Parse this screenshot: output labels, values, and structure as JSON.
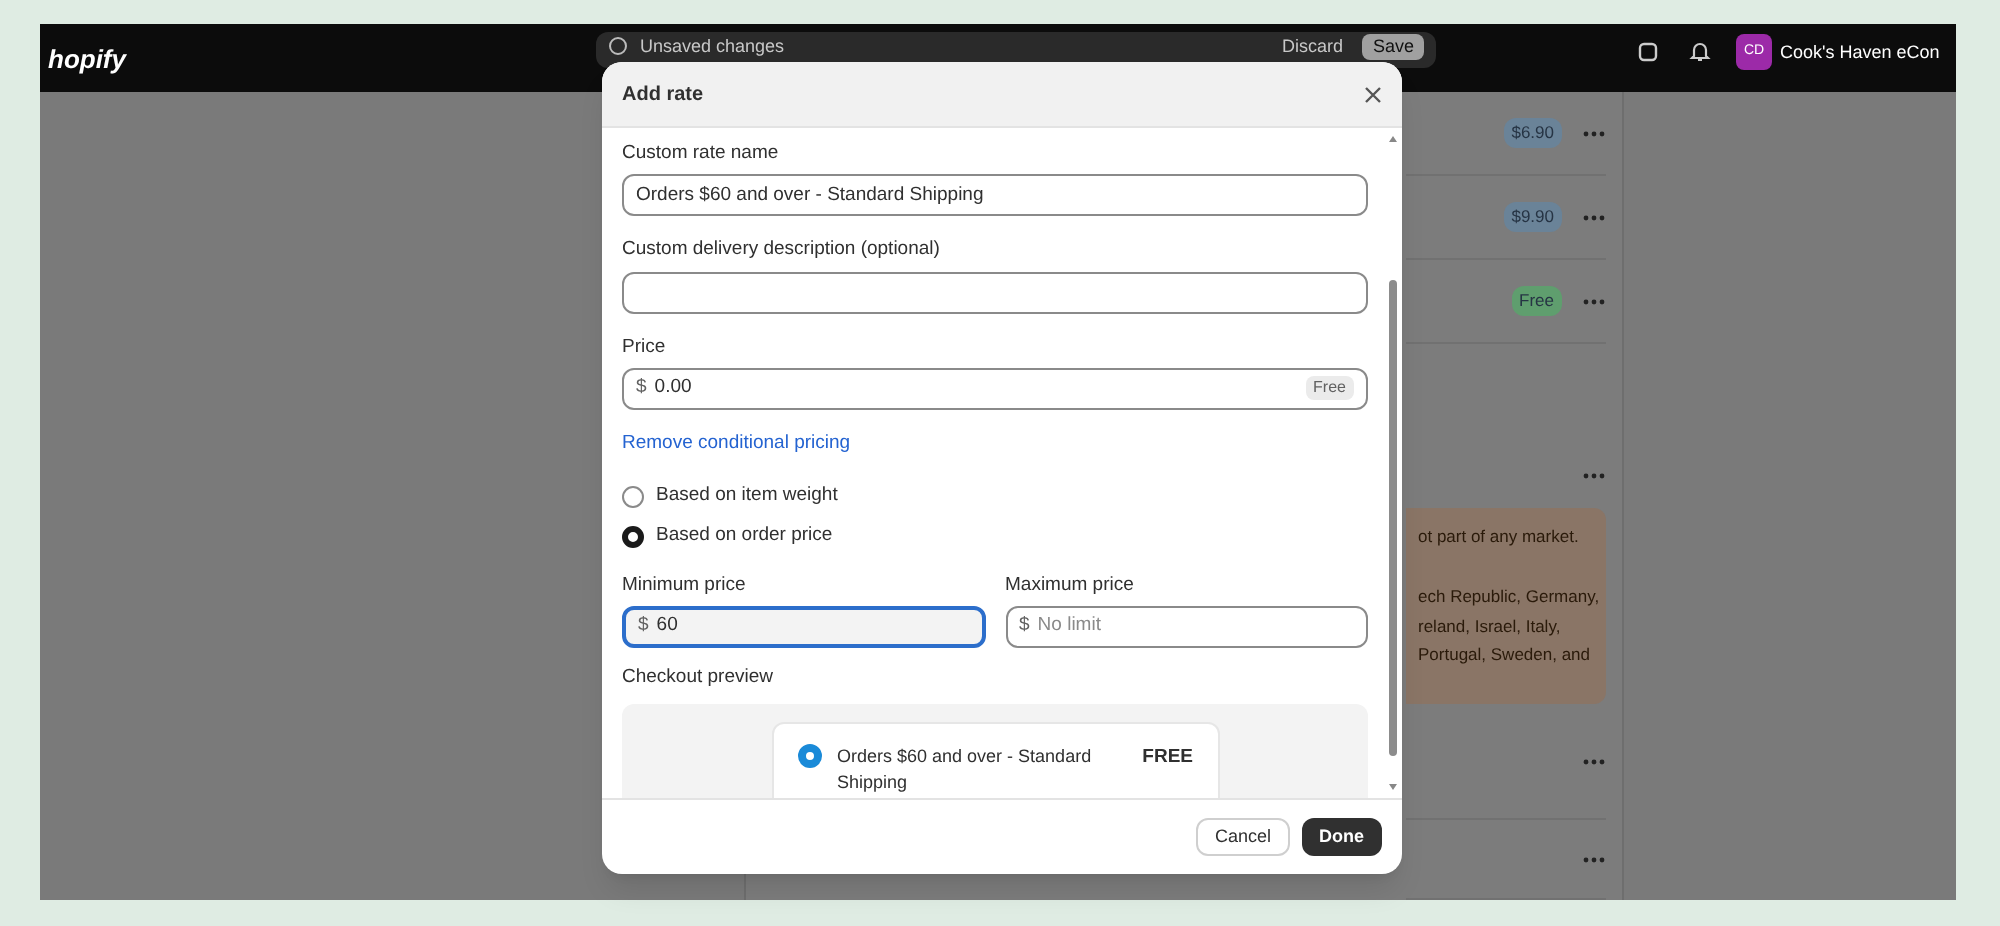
{
  "top_bar": {
    "logo": "hopify",
    "status": "Unsaved changes",
    "discard": "Discard",
    "save": "Save",
    "avatar": "CD",
    "store_name": "Cook's Haven eCon"
  },
  "background": {
    "rates": [
      {
        "badge": "$6.90",
        "color": "#6a8398"
      },
      {
        "badge": "$9.90",
        "color": "#6a8398"
      },
      {
        "badge": "Free",
        "color": "#5f9e6e"
      }
    ],
    "banner_lines": [
      "ot part of any market.",
      "ech Republic, Germany,",
      "reland, Israel, Italy,",
      "Portugal, Sweden, and"
    ]
  },
  "modal": {
    "title": "Add rate",
    "name_field": {
      "label": "Custom rate name",
      "value": "Orders $60 and over - Standard Shipping"
    },
    "description_field": {
      "label": "Custom delivery description (optional)"
    },
    "price_field": {
      "label": "Price",
      "prefix": "$",
      "value": "0.00",
      "tag": "Free"
    },
    "remove_link": "Remove conditional pricing",
    "conditions": [
      {
        "label": "Based on item weight",
        "selected": false
      },
      {
        "label": "Based on order price",
        "selected": true
      }
    ],
    "min_field": {
      "label": "Minimum price",
      "prefix": "$",
      "value": "60",
      "focused": true
    },
    "max_field": {
      "label": "Maximum price",
      "prefix": "$",
      "placeholder": "No limit",
      "focused": false
    },
    "preview": {
      "label": "Checkout preview",
      "option": {
        "name": "Orders $60 and over - Standard Shipping",
        "price": "FREE",
        "selected": true
      }
    },
    "cancel": "Cancel",
    "done": "Done"
  }
}
